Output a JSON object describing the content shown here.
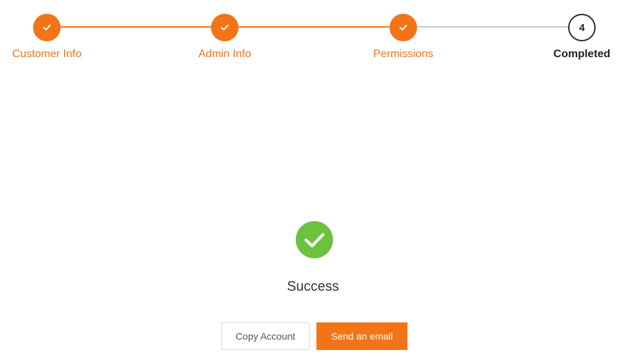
{
  "stepper": {
    "steps": [
      {
        "label": "Customer Info",
        "status": "done",
        "icon": "check-icon"
      },
      {
        "label": "Admin Info",
        "status": "done",
        "icon": "check-icon"
      },
      {
        "label": "Permissions",
        "status": "done",
        "icon": "check-icon"
      },
      {
        "label": "Completed",
        "status": "current",
        "number": "4"
      }
    ]
  },
  "result": {
    "icon": "success-check-icon",
    "title": "Success"
  },
  "actions": {
    "copy_label": "Copy Account",
    "email_label": "Send an email"
  },
  "colors": {
    "accent": "#f37317",
    "success": "#6cc13d",
    "pending_line": "#c8c8c8",
    "text_dark": "#222222"
  }
}
